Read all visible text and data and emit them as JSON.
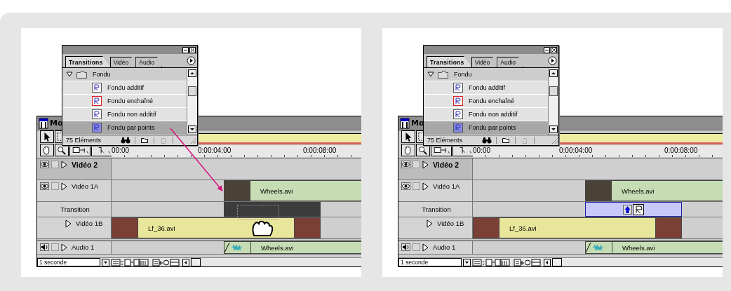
{
  "panels": [
    {
      "dragging": true,
      "palette": {
        "tabs": [
          {
            "label": "Transitions",
            "selected": true
          },
          {
            "label": "Vidéo",
            "selected": false
          },
          {
            "label": "Audio",
            "selected": false
          }
        ],
        "tree": [
          {
            "label": "Fondu",
            "expanded": true,
            "children": [
              {
                "label": "Fondu additif",
                "selected": false,
                "default": false
              },
              {
                "label": "Fondu enchaîné",
                "selected": false,
                "default": true
              },
              {
                "label": "Fondu non additif",
                "selected": false,
                "default": false
              },
              {
                "label": "Fondu par points",
                "selected": true,
                "default": false
              }
            ]
          }
        ],
        "count": "75 Eléments"
      },
      "timeline": {
        "title": "Mo",
        "ruler": [
          "00:00",
          "0:00:04:00",
          "0:00:08:00"
        ],
        "zoom": "1 seconde",
        "tracks": [
          {
            "kind": "video",
            "name": "Vidéo 2",
            "selected": true
          },
          {
            "kind": "video",
            "name": "Vidéo 1A",
            "selected": false,
            "clips": [
              {
                "kind": "gap"
              },
              {
                "kind": "open",
                "label": "Wheels.avi",
                "color": "#c6dcb4"
              }
            ]
          },
          {
            "kind": "transition",
            "name": "Transition",
            "selected": false,
            "clips": [
              {
                "kind": "gap"
              },
              {
                "kind": "drop-target"
              }
            ]
          },
          {
            "kind": "subtrack",
            "name": "Vidéo 1B",
            "selected": false,
            "clips": [
              {
                "kind": "closed",
                "label": "Lf_36.avi",
                "color": "#e8e69a"
              }
            ]
          },
          {
            "kind": "audio",
            "name": "Audio 1",
            "selected": false,
            "clips": [
              {
                "kind": "gap"
              },
              {
                "kind": "open",
                "label": "Wheels.avi",
                "color": "#c6dcb4"
              }
            ]
          }
        ]
      }
    },
    {
      "dragging": false,
      "palette": {
        "tabs": [
          {
            "label": "Transitions",
            "selected": true
          },
          {
            "label": "Vidéo",
            "selected": false
          },
          {
            "label": "Audio",
            "selected": false
          }
        ],
        "tree": [
          {
            "label": "Fondu",
            "expanded": true,
            "children": [
              {
                "label": "Fondu additif",
                "selected": false,
                "default": false
              },
              {
                "label": "Fondu enchaîné",
                "selected": false,
                "default": true
              },
              {
                "label": "Fondu non additif",
                "selected": false,
                "default": false
              },
              {
                "label": "Fondu par points",
                "selected": true,
                "default": false
              }
            ]
          }
        ],
        "count": "75 Eléments"
      },
      "timeline": {
        "title": "Mo",
        "ruler": [
          "00:00",
          "0:00:04:00",
          "0:00:08:00"
        ],
        "zoom": "1 seconde",
        "tracks": [
          {
            "kind": "video",
            "name": "Vidéo 2",
            "selected": true
          },
          {
            "kind": "video",
            "name": "Vidéo 1A",
            "selected": false,
            "clips": [
              {
                "kind": "gap"
              },
              {
                "kind": "open",
                "label": "Wheels.avi",
                "color": "#c6dcb4"
              }
            ]
          },
          {
            "kind": "transition",
            "name": "Transition",
            "selected": false,
            "clips": [
              {
                "kind": "gap"
              },
              {
                "kind": "transition"
              }
            ]
          },
          {
            "kind": "subtrack",
            "name": "Vidéo 1B",
            "selected": false,
            "clips": [
              {
                "kind": "closed",
                "label": "Lf_36.avi",
                "color": "#e8e69a"
              }
            ]
          },
          {
            "kind": "audio",
            "name": "Audio 1",
            "selected": false,
            "clips": [
              {
                "kind": "gap"
              },
              {
                "kind": "open",
                "label": "Wheels.avi",
                "color": "#c6dcb4"
              }
            ]
          }
        ]
      }
    }
  ]
}
